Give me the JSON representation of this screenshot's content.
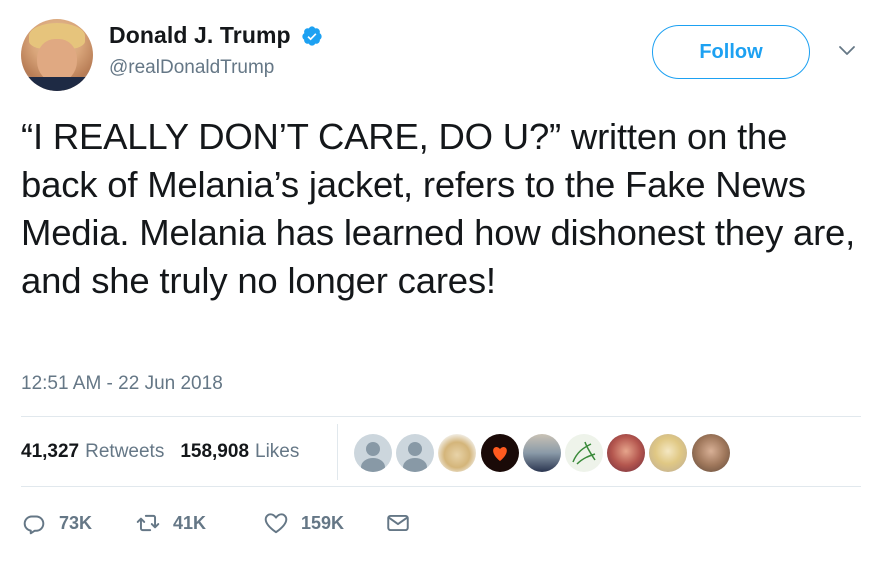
{
  "author": {
    "display_name": "Donald J. Trump",
    "handle": "@realDonaldTrump",
    "verified": true
  },
  "follow_label": "Follow",
  "tweet": {
    "text": "“I REALLY DON’T CARE, DO U?” written on the back of Melania’s jacket, refers to the Fake News Media. Melania has learned how dishonest they are, and she truly no longer cares!",
    "timestamp": "12:51 AM - 22 Jun 2018"
  },
  "stats": {
    "retweets_count": "41,327",
    "retweets_label": "Retweets",
    "likes_count": "158,908",
    "likes_label": "Likes"
  },
  "likers": [
    {
      "icon": "default-avatar-icon"
    },
    {
      "icon": "default-avatar-icon"
    },
    {
      "icon": "dog-avatar-icon"
    },
    {
      "icon": "heart-avatar-icon"
    },
    {
      "icon": "couple-avatar-icon"
    },
    {
      "icon": "sketch-avatar-icon"
    },
    {
      "icon": "woman-avatar-icon"
    },
    {
      "icon": "blonde-avatar-icon"
    },
    {
      "icon": "woman-avatar-icon"
    }
  ],
  "actions": {
    "replies": "73K",
    "retweets": "41K",
    "likes": "159K"
  },
  "colors": {
    "accent": "#1da1f2",
    "secondary_text": "#657786",
    "primary_text": "#14171a",
    "divider": "#e1e8ed"
  }
}
